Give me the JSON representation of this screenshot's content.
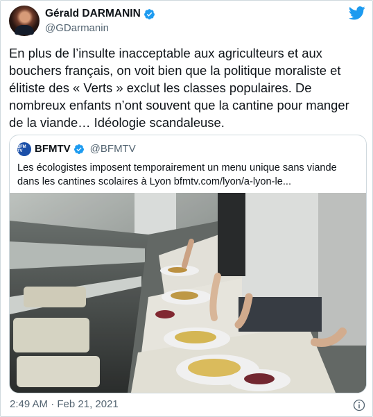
{
  "tweet": {
    "author": {
      "name": "Gérald DARMANIN",
      "handle": "@GDarmanin",
      "verified": true
    },
    "text": "En plus de l’insulte inacceptable aux agriculteurs et aux bouchers français, on voit bien que la politique moraliste et élitiste des « Verts » exclut les classes populaires. De nombreux enfants n’ont souvent que la cantine pour manger de la viande… Idéologie scandaleuse.",
    "timestamp": "2:49 AM · Feb 21, 2021"
  },
  "quoted_tweet": {
    "avatar_text": "BFM TV",
    "name": "BFMTV",
    "handle": "@BFMTV",
    "verified": true,
    "text": "Les écologistes imposent temporairement un menu unique sans viande dans les cantines scolaires à Lyon bfmtv.com/lyon/a-lyon-le..."
  },
  "icons": {
    "brand": "twitter-bird-icon",
    "verified": "verified-badge-icon",
    "info": "info-icon"
  },
  "colors": {
    "twitter_blue": "#1d9bf0",
    "secondary_text": "#536471",
    "border": "#cfd9de"
  }
}
